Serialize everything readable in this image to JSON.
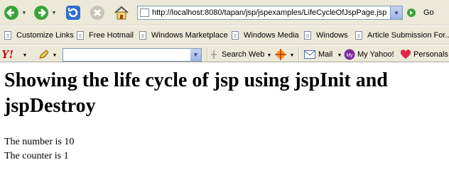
{
  "toolbar": {
    "back_icon": "back-arrow-icon",
    "forward_icon": "forward-arrow-icon",
    "refresh_icon": "refresh-icon",
    "stop_icon": "stop-icon",
    "home_icon": "home-icon",
    "address_url": "http://localhost:8080/tapan/jsp/jspexamples/LifeCycleOfJspPage.jsp",
    "go_label": "Go"
  },
  "links_bar": {
    "items": [
      {
        "label": "Customize Links"
      },
      {
        "label": "Free Hotmail"
      },
      {
        "label": "Windows Marketplace"
      },
      {
        "label": "Windows Media"
      },
      {
        "label": "Windows"
      },
      {
        "label": "Article Submission For..."
      }
    ]
  },
  "yahoo_bar": {
    "logo_text": "Y!",
    "search_placeholder": "",
    "search_web_label": "Search Web",
    "mail_label": "Mail",
    "my_yahoo_label": "My Yahoo!",
    "personals_label": "Personals"
  },
  "page": {
    "heading": "Showing the life cycle of jsp using jspInit and jspDestroy",
    "number_line": "The number is 10",
    "counter_line": "The counter is 1"
  },
  "colors": {
    "nav_green": "#3aa33a",
    "refresh_blue": "#2e6fd0",
    "yahoo_red": "#cc0000"
  }
}
